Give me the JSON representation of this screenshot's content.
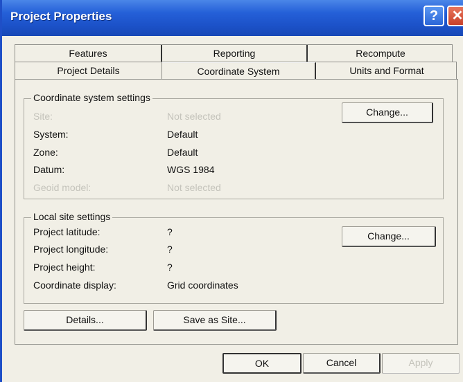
{
  "window": {
    "title": "Project Properties",
    "help_glyph": "?",
    "close_glyph": "✕"
  },
  "tabs": {
    "row1": [
      "Features",
      "Reporting",
      "Recompute"
    ],
    "row2": [
      "Project Details",
      "Coordinate System",
      "Units and Format"
    ],
    "active": "Coordinate System"
  },
  "coordinate_settings": {
    "title": "Coordinate system settings",
    "rows": [
      {
        "label": "Site:",
        "value": "Not selected",
        "enabled": false
      },
      {
        "label": "System:",
        "value": "Default",
        "enabled": true
      },
      {
        "label": "Zone:",
        "value": "Default",
        "enabled": true
      },
      {
        "label": "Datum:",
        "value": "WGS 1984",
        "enabled": true
      },
      {
        "label": "Geoid model:",
        "value": "Not selected",
        "enabled": false
      }
    ],
    "change_label": "Change..."
  },
  "local_site": {
    "title": "Local site settings",
    "rows": [
      {
        "label": "Project latitude:",
        "value": "?"
      },
      {
        "label": "Project longitude:",
        "value": "?"
      },
      {
        "label": "Project height:",
        "value": "?"
      },
      {
        "label": "Coordinate display:",
        "value": "Grid coordinates"
      }
    ],
    "change_label": "Change..."
  },
  "panel_buttons": {
    "details": "Details...",
    "save_as_site": "Save as Site..."
  },
  "dialog_buttons": {
    "ok": "OK",
    "cancel": "Cancel",
    "apply": "Apply"
  }
}
